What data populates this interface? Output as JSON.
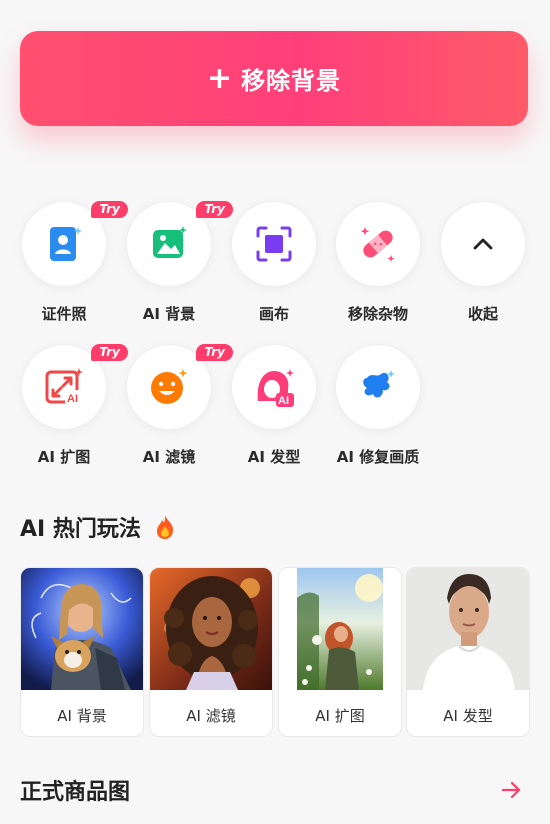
{
  "primary_action": {
    "icon": "plus-icon",
    "label": "移除背景"
  },
  "tools": [
    {
      "label": "证件照",
      "icon": "id-photo-icon",
      "badge": "Try"
    },
    {
      "label": "AI 背景",
      "icon": "image-sparkle-icon",
      "badge": "Try"
    },
    {
      "label": "画布",
      "icon": "canvas-frame-icon",
      "badge": ""
    },
    {
      "label": "移除杂物",
      "icon": "bandage-eraser-icon",
      "badge": ""
    },
    {
      "label": "收起",
      "icon": "chevron-up-icon",
      "badge": ""
    },
    {
      "label": "AI 扩图",
      "icon": "expand-ai-icon",
      "badge": "Try"
    },
    {
      "label": "AI 滤镜",
      "icon": "smiley-filter-icon",
      "badge": "Try"
    },
    {
      "label": "AI 发型",
      "icon": "hairstyle-ai-icon",
      "badge": ""
    },
    {
      "label": "AI 修复画质",
      "icon": "repair-splash-icon",
      "badge": ""
    }
  ],
  "hot_section": {
    "title": "AI 热门玩法",
    "title_icon": "fire-icon",
    "cards": [
      {
        "caption": "AI 背景",
        "image": "woman-with-dog-thumbnail"
      },
      {
        "caption": "AI 滤镜",
        "image": "curly-hair-woman-thumbnail"
      },
      {
        "caption": "AI 扩图",
        "image": "woman-in-field-thumbnail"
      },
      {
        "caption": "AI 发型",
        "image": "man-portrait-thumbnail"
      }
    ]
  },
  "product_section": {
    "title": "正式商品图",
    "action_icon": "arrow-right-icon"
  },
  "colors": {
    "accent": "#ff3d6a",
    "button_gradient_start": "#ff4f6e",
    "button_gradient_end": "#ff5a6a"
  }
}
